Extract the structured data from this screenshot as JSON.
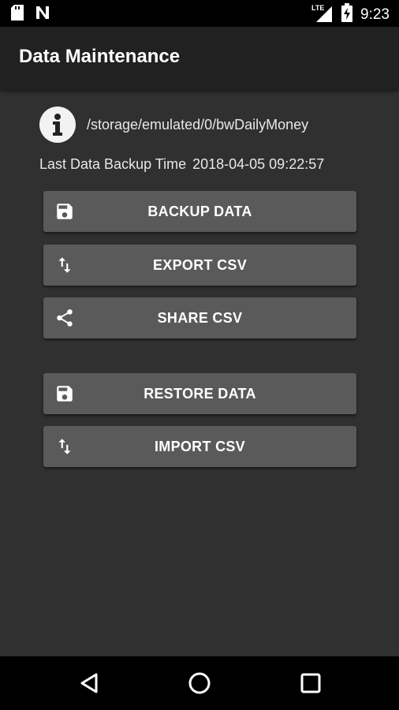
{
  "status_bar": {
    "time": "9:23",
    "network": "LTE",
    "icons": [
      "sd-card-icon",
      "n-notification-icon",
      "lte-signal-icon",
      "battery-charging-icon"
    ]
  },
  "app_bar": {
    "title": "Data Maintenance"
  },
  "info": {
    "icon": "info-icon",
    "path": "/storage/emulated/0/bwDailyMoney"
  },
  "backup": {
    "label": "Last Data Backup Time",
    "time": "2018-04-05 09:22:57"
  },
  "buttons": [
    {
      "label": "BACKUP DATA",
      "icon": "save-icon"
    },
    {
      "label": "EXPORT CSV",
      "icon": "swap-vertical-icon"
    },
    {
      "label": "SHARE CSV",
      "icon": "share-icon"
    },
    {
      "label": "RESTORE DATA",
      "icon": "save-icon"
    },
    {
      "label": "IMPORT CSV",
      "icon": "swap-vertical-icon"
    }
  ],
  "nav_bar": {
    "icons": [
      "back-icon",
      "home-icon",
      "recents-icon"
    ]
  },
  "colors": {
    "background": "#303030",
    "app_bar": "#212121",
    "button": "#5a5a5a",
    "text": "#ffffff"
  }
}
